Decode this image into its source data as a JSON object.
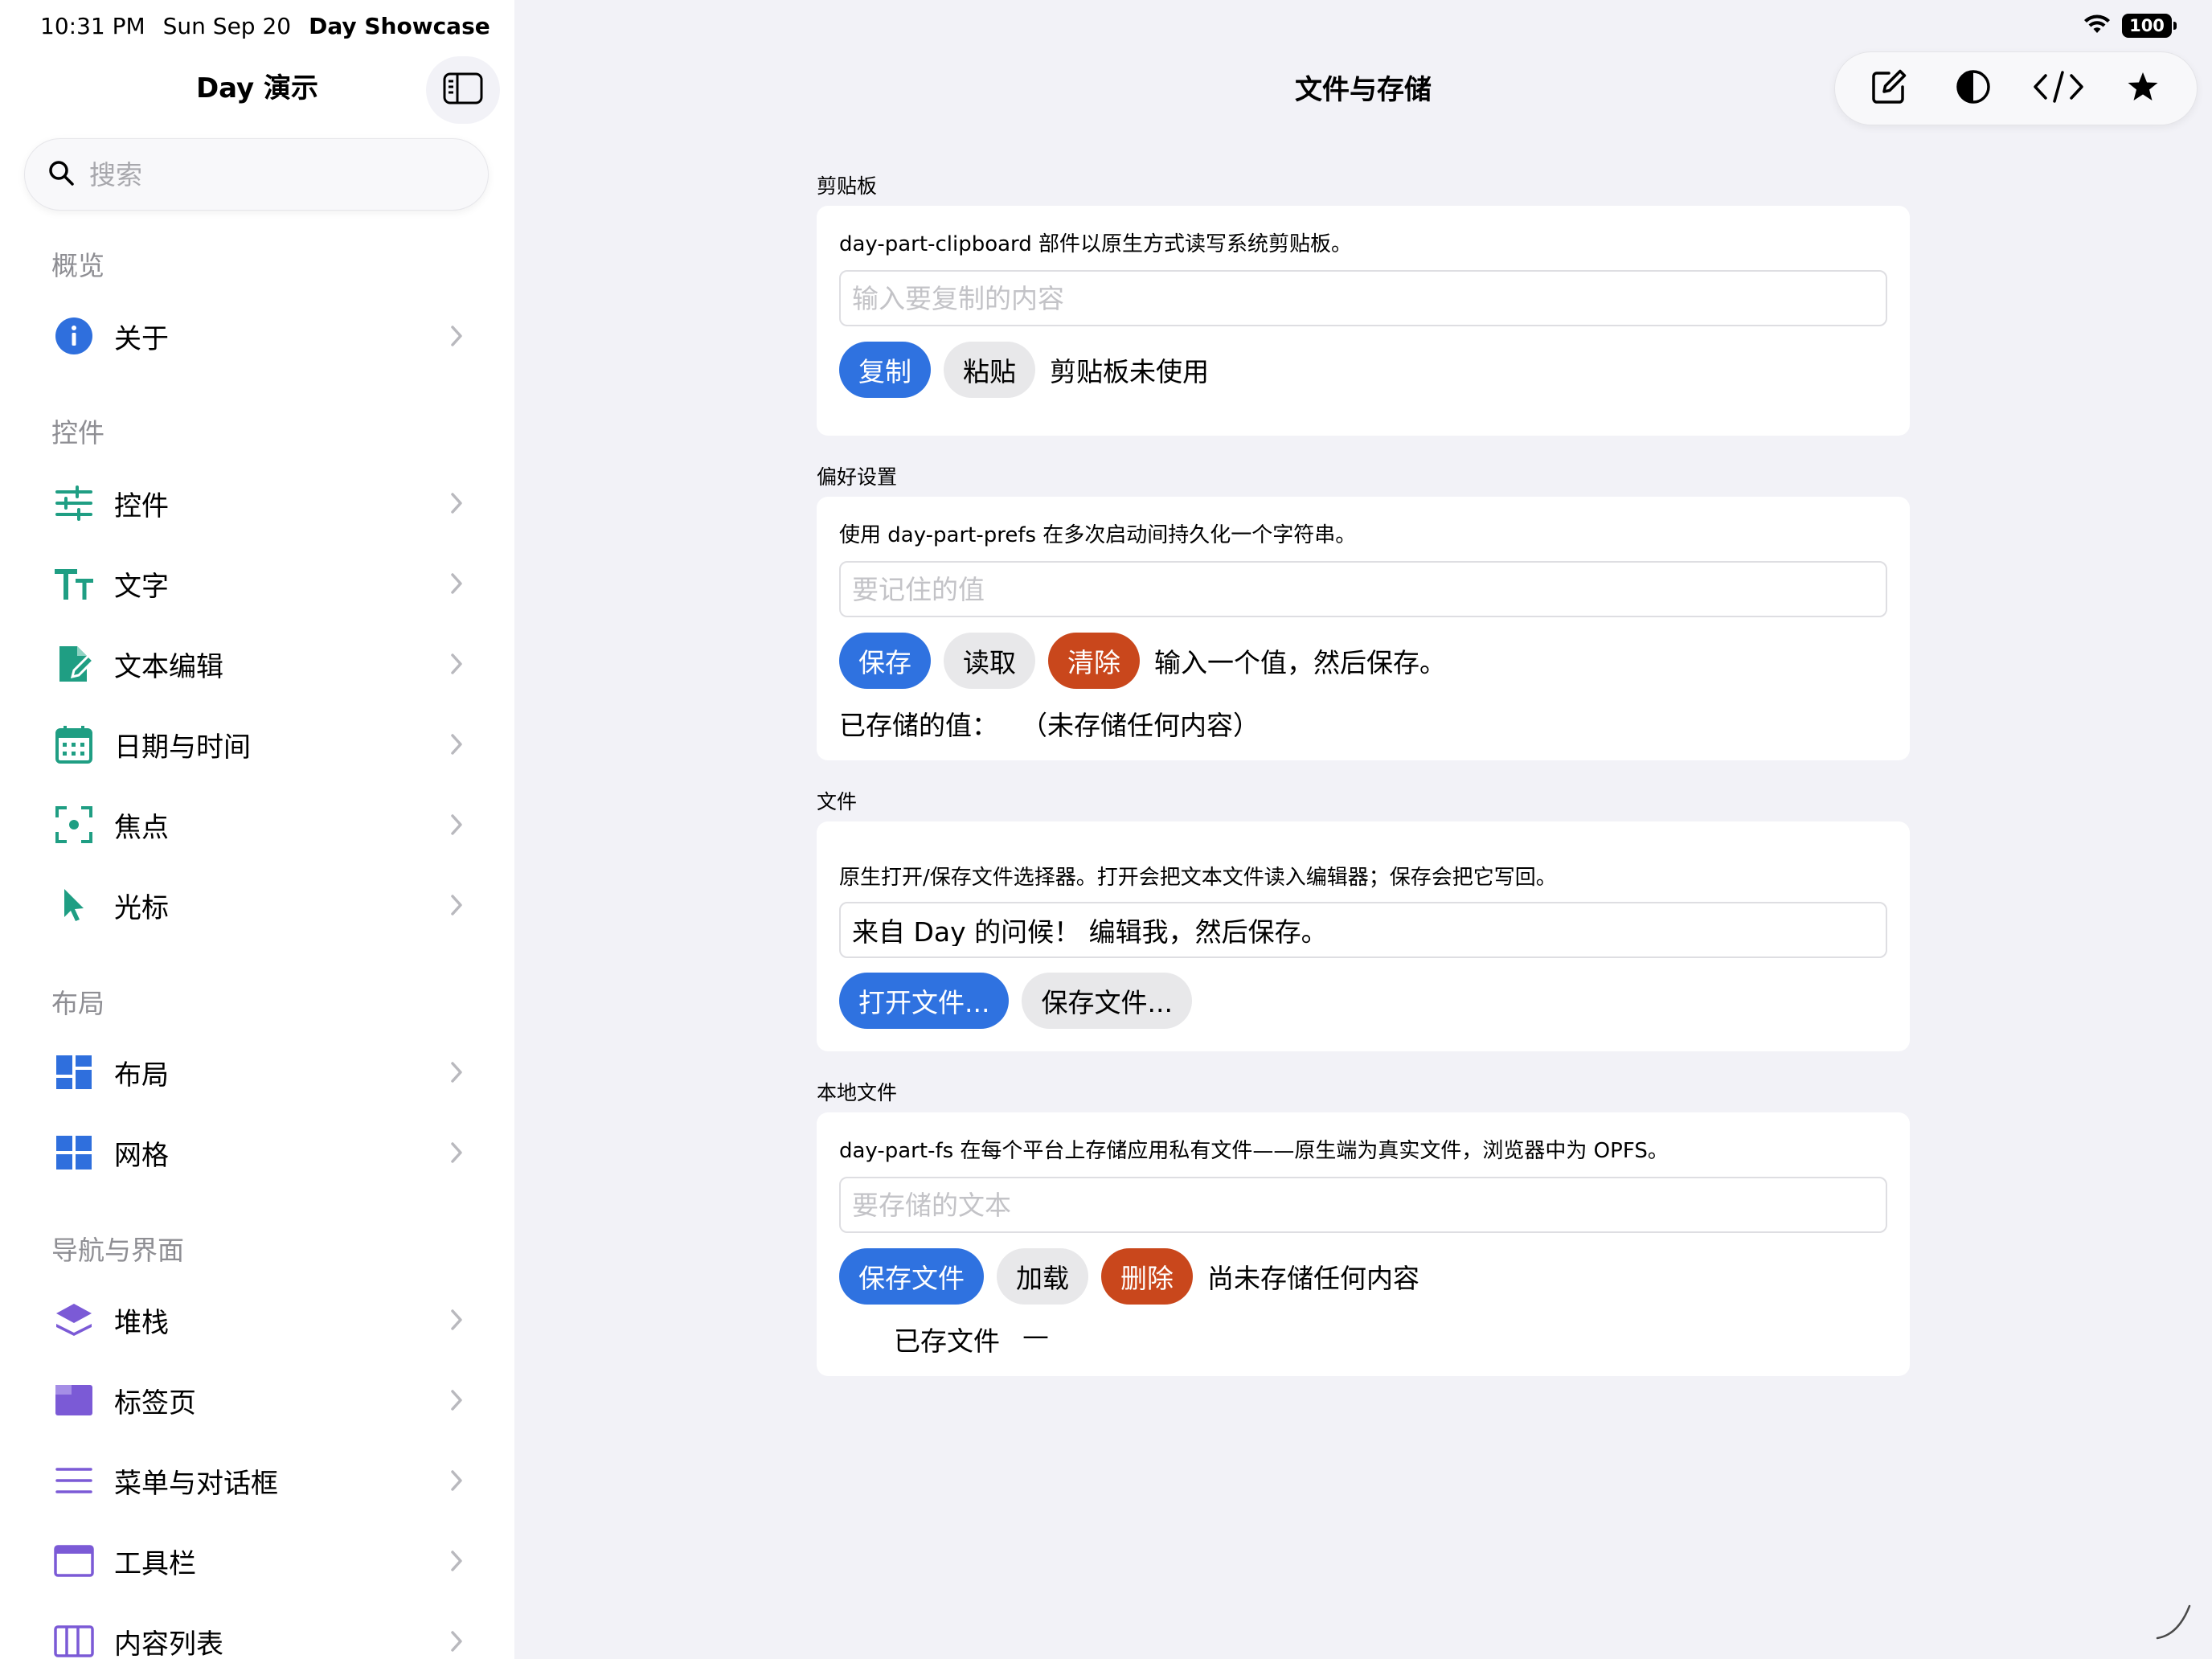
{
  "status_bar": {
    "time": "10:31 PM",
    "date": "Sun Sep 20",
    "app_name": "Day Showcase",
    "battery": "100"
  },
  "sidebar": {
    "title": "Day 演示",
    "search_placeholder": "搜索",
    "sections": [
      {
        "header": "概览",
        "items": [
          {
            "label": "关于",
            "icon": "info-icon"
          }
        ]
      },
      {
        "header": "控件",
        "items": [
          {
            "label": "控件",
            "icon": "sliders-icon"
          },
          {
            "label": "文字",
            "icon": "text-size-icon"
          },
          {
            "label": "文本编辑",
            "icon": "edit-document-icon"
          },
          {
            "label": "日期与时间",
            "icon": "calendar-icon"
          },
          {
            "label": "焦点",
            "icon": "focus-icon"
          },
          {
            "label": "光标",
            "icon": "cursor-icon"
          }
        ]
      },
      {
        "header": "布局",
        "items": [
          {
            "label": "布局",
            "icon": "layout-icon"
          },
          {
            "label": "网格",
            "icon": "grid-icon"
          }
        ]
      },
      {
        "header": "导航与界面",
        "items": [
          {
            "label": "堆栈",
            "icon": "layers-icon"
          },
          {
            "label": "标签页",
            "icon": "tabs-icon"
          },
          {
            "label": "菜单与对话框",
            "icon": "menu-icon"
          },
          {
            "label": "工具栏",
            "icon": "toolbar-icon"
          },
          {
            "label": "内容列表",
            "icon": "content-list-icon"
          }
        ]
      }
    ]
  },
  "header": {
    "title": "文件与存储",
    "toolbar_icons": [
      "compose-icon",
      "contrast-icon",
      "code-icon",
      "star-icon"
    ]
  },
  "main": {
    "clipboard": {
      "label": "剪贴板",
      "description": "day-part-clipboard 部件以原生方式读写系统剪贴板。",
      "input_placeholder": "输入要复制的内容",
      "input_value": "",
      "copy_button": "复制",
      "paste_button": "粘贴",
      "status": "剪贴板未使用"
    },
    "prefs": {
      "label": "偏好设置",
      "description": "使用 day-part-prefs 在多次启动间持久化一个字符串。",
      "input_placeholder": "要记住的值",
      "input_value": "",
      "save_button": "保存",
      "read_button": "读取",
      "clear_button": "清除",
      "status": "输入一个值，然后保存。",
      "stored_label": "已存储的值：",
      "stored_value": "（未存储任何内容）"
    },
    "files": {
      "label": "文件",
      "description": "原生打开/保存文件选择器。打开会把文本文件读入编辑器；保存会把它写回。",
      "input_value": "来自 Day 的问候！ 编辑我，然后保存。",
      "open_button": "打开文件...",
      "save_button": "保存文件..."
    },
    "local_files": {
      "label": "本地文件",
      "description": "day-part-fs 在每个平台上存储应用私有文件——原生端为真实文件，浏览器中为 OPFS。",
      "input_placeholder": "要存储的文本",
      "input_value": "",
      "save_button": "保存文件",
      "load_button": "加载",
      "delete_button": "删除",
      "status": "尚未存储任何内容",
      "saved_label": "已存文件",
      "saved_value": "—"
    }
  },
  "colors": {
    "primary": "#2f72e0",
    "danger": "#c9471c",
    "secondary": "#e8e8ea",
    "teal_icon": "#1f9e83",
    "blue_icon": "#2f6fdd",
    "purple_icon": "#7b5ad6"
  }
}
